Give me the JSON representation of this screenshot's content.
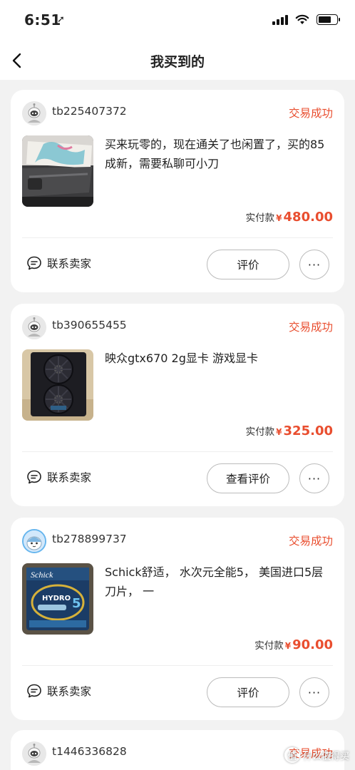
{
  "status_bar": {
    "time": "6:51",
    "location_arrow": "➚"
  },
  "nav": {
    "title": "我买到的",
    "back_icon": "chevron-left-icon"
  },
  "colors": {
    "accent": "#e94e2f",
    "background": "#f2f2f2"
  },
  "orders": [
    {
      "seller": "tb225407372",
      "status": "交易成功",
      "description": "买来玩零的，现在通关了也闲置了，买的85成新，需要私聊可小刀",
      "price_label": "实付款",
      "currency": "¥",
      "amount": "480.00",
      "contact_label": "联系卖家",
      "review_label": "评价",
      "more_label": "···"
    },
    {
      "seller": "tb390655455",
      "status": "交易成功",
      "description": "映众gtx670 2g显卡 游戏显卡",
      "price_label": "实付款",
      "currency": "¥",
      "amount": "325.00",
      "contact_label": "联系卖家",
      "review_label": "查看评价",
      "more_label": "···"
    },
    {
      "seller": "tb278899737",
      "status": "交易成功",
      "description": "Schick舒适， 水次元全能5， 美国进口5层刀片， 一",
      "price_label": "实付款",
      "currency": "¥",
      "amount": "90.00",
      "contact_label": "联系卖家",
      "review_label": "评价",
      "more_label": "···",
      "product_image_text": {
        "brand": "Schick",
        "line": "HYDRO",
        "number": "5"
      }
    },
    {
      "seller": "t1446336828",
      "status": "交易成功"
    }
  ],
  "watermark": {
    "symbol": "值",
    "text": "什么值得买"
  }
}
